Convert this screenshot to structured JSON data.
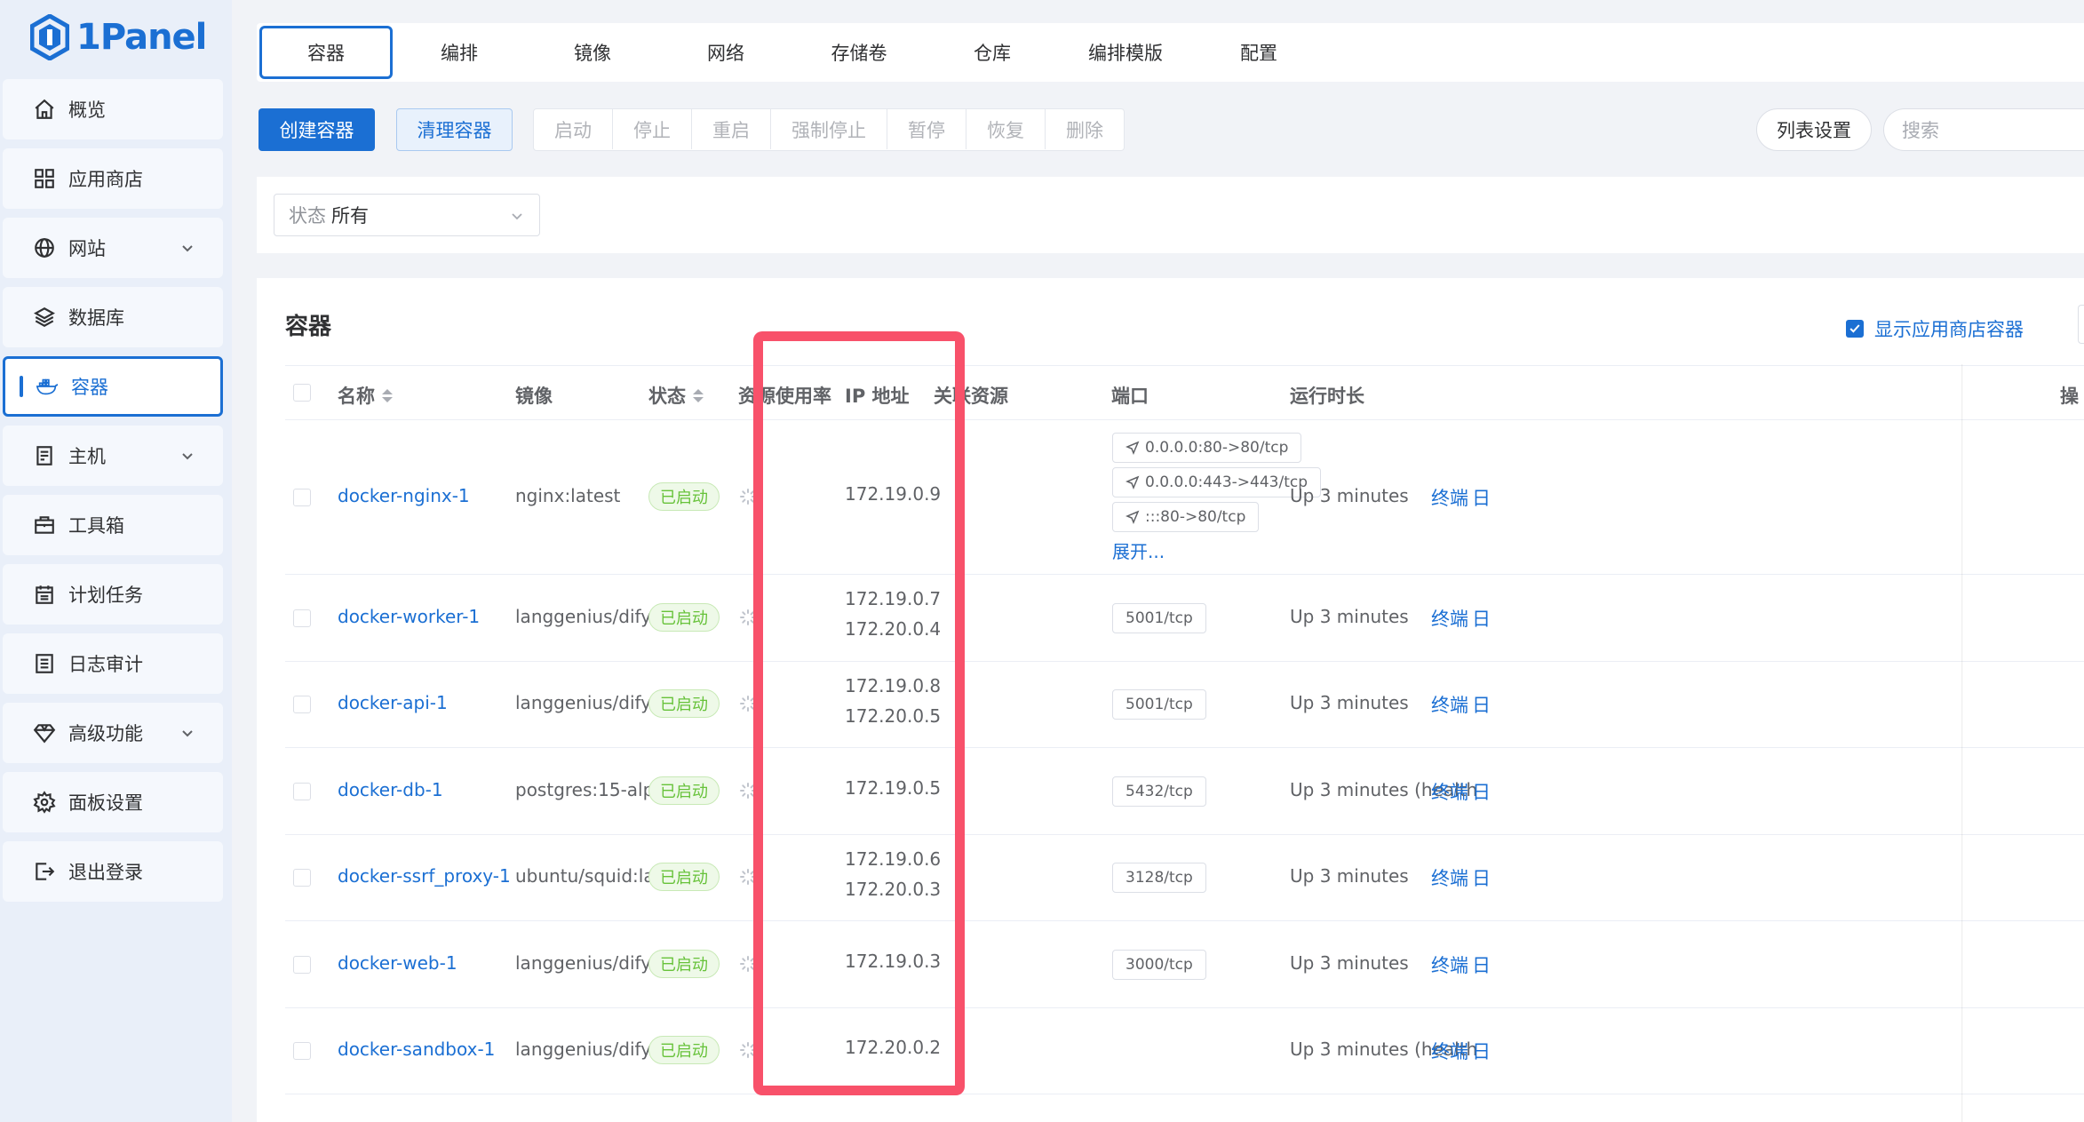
{
  "app": {
    "logo_text": "1Panel"
  },
  "sidebar": {
    "items": [
      {
        "label": "概览",
        "icon": "home-icon"
      },
      {
        "label": "应用商店",
        "icon": "apps-icon"
      },
      {
        "label": "网站",
        "icon": "globe-icon",
        "expandable": true
      },
      {
        "label": "数据库",
        "icon": "layers-icon"
      },
      {
        "label": "容器",
        "icon": "docker-icon",
        "active": true
      },
      {
        "label": "主机",
        "icon": "server-icon",
        "expandable": true
      },
      {
        "label": "工具箱",
        "icon": "toolbox-icon"
      },
      {
        "label": "计划任务",
        "icon": "calendar-icon"
      },
      {
        "label": "日志审计",
        "icon": "log-icon"
      },
      {
        "label": "高级功能",
        "icon": "diamond-icon",
        "expandable": true
      },
      {
        "label": "面板设置",
        "icon": "gear-icon"
      },
      {
        "label": "退出登录",
        "icon": "logout-icon"
      }
    ]
  },
  "tabs": [
    "容器",
    "编排",
    "镜像",
    "网络",
    "存储卷",
    "仓库",
    "编排模版",
    "配置"
  ],
  "toolbar": {
    "create": "创建容器",
    "clean": "清理容器",
    "actions": [
      "启动",
      "停止",
      "重启",
      "强制停止",
      "暂停",
      "恢复",
      "删除"
    ],
    "list_settings": "列表设置",
    "search_placeholder": "搜索"
  },
  "filter": {
    "label": "状态",
    "value": "所有"
  },
  "card": {
    "title": "容器",
    "show_app_containers": "显示应用商店容器",
    "show_app_checked": true
  },
  "table": {
    "headers": {
      "name": "名称",
      "image": "镜像",
      "status": "状态",
      "resource": "资源使用率",
      "ip": "IP 地址",
      "related": "关联资源",
      "port": "端口",
      "uptime": "运行时长",
      "ops": "操"
    },
    "rows": [
      {
        "name": "docker-nginx-1",
        "image": "nginx:latest",
        "status": "已启动",
        "ip": [
          "172.19.0.9"
        ],
        "ports": [
          "0.0.0.0:80->80/tcp",
          "0.0.0.0:443->443/tcp",
          ":::80->80/tcp"
        ],
        "expand": "展开...",
        "uptime": "Up 3 minutes",
        "op1": "终端",
        "op2": "日"
      },
      {
        "name": "docker-worker-1",
        "image": "langgenius/dify-a...",
        "status": "已启动",
        "ip": [
          "172.19.0.7",
          "172.20.0.4"
        ],
        "ports": [
          "5001/tcp"
        ],
        "uptime": "Up 3 minutes",
        "op1": "终端",
        "op2": "日"
      },
      {
        "name": "docker-api-1",
        "image": "langgenius/dify-a...",
        "status": "已启动",
        "ip": [
          "172.19.0.8",
          "172.20.0.5"
        ],
        "ports": [
          "5001/tcp"
        ],
        "uptime": "Up 3 minutes",
        "op1": "终端",
        "op2": "日"
      },
      {
        "name": "docker-db-1",
        "image": "postgres:15-alpine",
        "status": "已启动",
        "ip": [
          "172.19.0.5"
        ],
        "ports": [
          "5432/tcp"
        ],
        "uptime": "Up 3 minutes (health",
        "op1": "终端",
        "op2": "日"
      },
      {
        "name": "docker-ssrf_proxy-1",
        "image": "ubuntu/squid:latest",
        "status": "已启动",
        "ip": [
          "172.19.0.6",
          "172.20.0.3"
        ],
        "ports": [
          "3128/tcp"
        ],
        "uptime": "Up 3 minutes",
        "op1": "终端",
        "op2": "日"
      },
      {
        "name": "docker-web-1",
        "image": "langgenius/dify-w...",
        "status": "已启动",
        "ip": [
          "172.19.0.3"
        ],
        "ports": [
          "3000/tcp"
        ],
        "uptime": "Up 3 minutes",
        "op1": "终端",
        "op2": "日"
      },
      {
        "name": "docker-sandbox-1",
        "image": "langgenius/dify-s...",
        "status": "已启动",
        "ip": [
          "172.20.0.2"
        ],
        "ports": [],
        "uptime": "Up 3 minutes (health",
        "op1": "终端",
        "op2": "日"
      }
    ]
  },
  "colors": {
    "primary": "#1b6fd3",
    "success": "#67c23a",
    "highlight": "#f8516a"
  }
}
